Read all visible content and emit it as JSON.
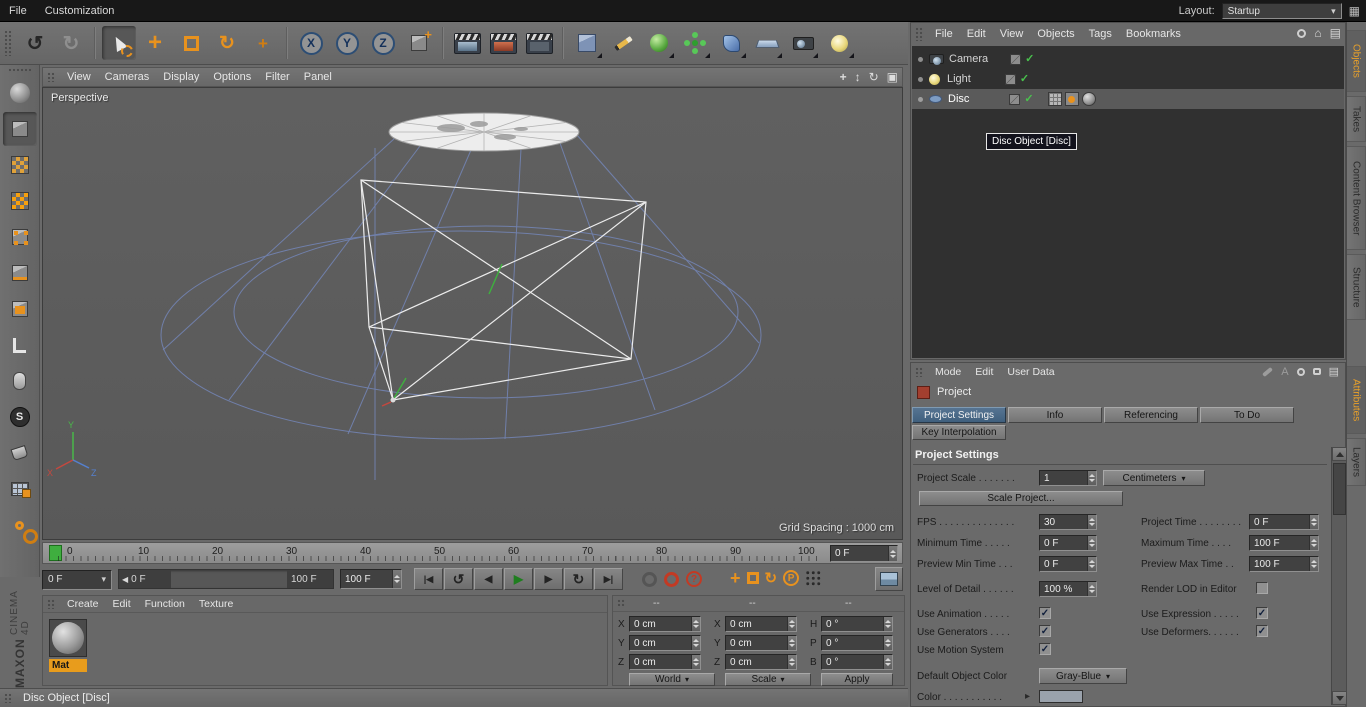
{
  "colors": {
    "accent_orange": "#e8921e",
    "selected_blue": "#40607e",
    "green": "#2f9e2f",
    "red": "#c23a24",
    "viewport_line_blue": "#7486b8"
  },
  "icons": {
    "undo": "↺",
    "redo": "↻",
    "x": "X",
    "y": "Y",
    "z": "Z",
    "caret": "▾",
    "arrow_right": "▸",
    "grid": "▦",
    "panel": "▤",
    "home": "⌂",
    "letter_a": "A",
    "s": "S",
    "p": "P",
    "question": "?",
    "move": "+",
    "pan": "+",
    "updown": "↕",
    "rotate": "↻",
    "toggle_view": "▣",
    "goto_start": "|◀",
    "prev_key": "↺",
    "prev_frame": "◀",
    "play": "▶",
    "next_frame": "▶",
    "next_key": "↻",
    "goto_end": "▶|",
    "left_small": "◀"
  },
  "menubar": {
    "items": [
      "File",
      "Customization"
    ],
    "layout_label": "Layout:",
    "layout_value": "Startup"
  },
  "viewport": {
    "menu": [
      "View",
      "Cameras",
      "Display",
      "Options",
      "Filter",
      "Panel"
    ],
    "label": "Perspective",
    "grid_spacing": "Grid Spacing : 1000 cm"
  },
  "timeline": {
    "ticks": [
      "0",
      "10",
      "20",
      "30",
      "40",
      "50",
      "60",
      "70",
      "80",
      "90",
      "100"
    ],
    "frame_field": "0 F",
    "range_start_field": "0 F",
    "range_slider_left": "0 F",
    "range_slider_right": "100 F",
    "range_end_field": "100 F"
  },
  "material": {
    "menu": [
      "Create",
      "Edit",
      "Function",
      "Texture"
    ],
    "name": "Mat"
  },
  "coords": {
    "headers": [
      "--",
      "--",
      "--"
    ],
    "rows": [
      {
        "c1": "X",
        "v1": "0 cm",
        "c2": "X",
        "v2": "0 cm",
        "c3": "H",
        "v3": "0 °"
      },
      {
        "c1": "Y",
        "v1": "0 cm",
        "c2": "Y",
        "v2": "0 cm",
        "c3": "P",
        "v3": "0 °"
      },
      {
        "c1": "Z",
        "v1": "0 cm",
        "c2": "Z",
        "v2": "0 cm",
        "c3": "B",
        "v3": "0 °"
      }
    ],
    "world": "World",
    "scale": "Scale",
    "apply": "Apply"
  },
  "object_manager": {
    "menu": [
      "File",
      "Edit",
      "View",
      "Objects",
      "Tags",
      "Bookmarks"
    ],
    "objects": [
      {
        "name": "Camera"
      },
      {
        "name": "Light"
      },
      {
        "name": "Disc"
      }
    ],
    "tooltip": "Disc Object [Disc]"
  },
  "attributes": {
    "menu": [
      "Mode",
      "Edit",
      "User Data"
    ],
    "title": "Project",
    "tabs": [
      "Project Settings",
      "Info",
      "Referencing",
      "To Do"
    ],
    "tab_row2": "Key Interpolation",
    "section": "Project Settings",
    "check": "✓",
    "project_scale_label": "Project Scale . . . . . . .",
    "project_scale_value": "1",
    "project_scale_unit": "Centimeters",
    "scale_project_button": "Scale Project...",
    "fps_label": "FPS . . . . . . . . . . . . . .",
    "fps_value": "30",
    "project_time_label": "Project Time . . . . . . . .",
    "project_time_value": "0 F",
    "min_time_label": "Minimum Time . . . . .",
    "min_time_value": "0 F",
    "max_time_label": "Maximum Time . . . .",
    "max_time_value": "100 F",
    "preview_min_label": "Preview Min Time . . .",
    "preview_min_value": "0 F",
    "preview_max_label": "Preview Max Time . .",
    "preview_max_value": "100 F",
    "lod_label": "Level of Detail . . . . . .",
    "lod_value": "100 %",
    "render_lod_label": "Render LOD in Editor",
    "use_animation_label": "Use Animation . . . . .",
    "use_expression_label": "Use Expression . . . . .",
    "use_generators_label": "Use Generators . . . .",
    "use_deformers_label": "Use Deformers. . . . . .",
    "use_motion_label": "Use Motion System",
    "default_color_label": "Default Object Color",
    "default_color_value": "Gray-Blue",
    "color_label": "Color . . . . . . . . . . ."
  },
  "right_tabs": {
    "top": [
      "Objects",
      "Takes",
      "Content Browser",
      "Structure"
    ],
    "bottom": [
      "Attributes",
      "Layers"
    ]
  },
  "statusbar": {
    "text": "Disc Object [Disc]"
  },
  "branding": {
    "line1": "MAXON",
    "line2": "CINEMA 4D"
  }
}
